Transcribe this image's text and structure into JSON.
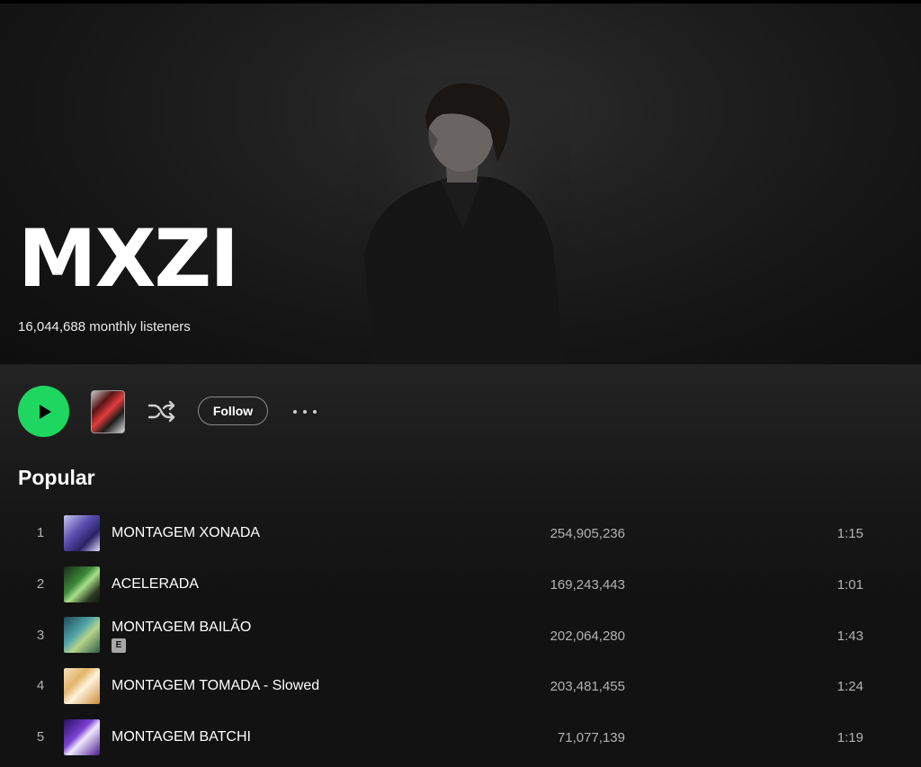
{
  "artist": {
    "name": "MXZI",
    "monthly_listeners": "16,044,688 monthly listeners"
  },
  "controls": {
    "play_icon": "play-icon",
    "shuffle_icon": "shuffle-icon",
    "follow_label": "Follow",
    "more_icon": "more-options-icon",
    "accent_color": "#1ed760"
  },
  "popular": {
    "title": "Popular",
    "tracks": [
      {
        "number": "1",
        "title": "MONTAGEM XONADA",
        "plays": "254,905,236",
        "duration": "1:15",
        "explicit": false
      },
      {
        "number": "2",
        "title": "ACELERADA",
        "plays": "169,243,443",
        "duration": "1:01",
        "explicit": false
      },
      {
        "number": "3",
        "title": "MONTAGEM BAILÃO",
        "plays": "202,064,280",
        "duration": "1:43",
        "explicit": true,
        "explicit_label": "E"
      },
      {
        "number": "4",
        "title": "MONTAGEM TOMADA - Slowed",
        "plays": "203,481,455",
        "duration": "1:24",
        "explicit": false
      },
      {
        "number": "5",
        "title": "MONTAGEM BATCHI",
        "plays": "71,077,139",
        "duration": "1:19",
        "explicit": false
      }
    ]
  }
}
